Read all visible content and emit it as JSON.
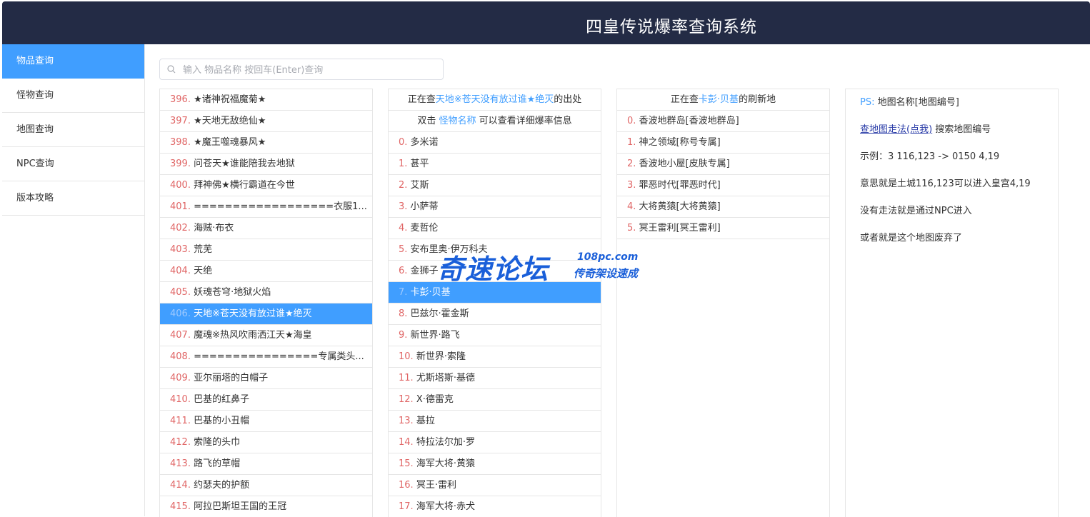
{
  "header": {
    "title": "四皇传说爆率查询系统"
  },
  "sidebar": {
    "items": [
      {
        "label": "物品查询",
        "active": true
      },
      {
        "label": "怪物查询",
        "active": false
      },
      {
        "label": "地图查询",
        "active": false
      },
      {
        "label": "NPC查询",
        "active": false
      },
      {
        "label": "版本攻略",
        "active": false
      }
    ]
  },
  "search": {
    "placeholder": "输入 物品名称 按回车(Enter)查询",
    "value": ""
  },
  "items_list": {
    "selected_index": 10,
    "rows": [
      {
        "num": "396.",
        "name": "★诸神祝福魔菊★"
      },
      {
        "num": "397.",
        "name": "★天地无敌绝仙★"
      },
      {
        "num": "398.",
        "name": "★魔王噬魂暴风★"
      },
      {
        "num": "399.",
        "name": "问苍天★谁能陪我去地狱"
      },
      {
        "num": "400.",
        "name": "拜神佛★横行霸道在今世"
      },
      {
        "num": "401.",
        "name": "==================衣服1..."
      },
      {
        "num": "402.",
        "name": "海贼·布衣"
      },
      {
        "num": "403.",
        "name": "荒芜"
      },
      {
        "num": "404.",
        "name": "天绝"
      },
      {
        "num": "405.",
        "name": "妖魂苍穹·地狱火焰"
      },
      {
        "num": "406.",
        "name": "天地※苍天没有放过谁★绝灭"
      },
      {
        "num": "407.",
        "name": "魔魂※热风吹雨洒江天★海皇"
      },
      {
        "num": "408.",
        "name": "================专属类头..."
      },
      {
        "num": "409.",
        "name": "亚尔丽塔的白帽子"
      },
      {
        "num": "410.",
        "name": "巴基的红鼻子"
      },
      {
        "num": "411.",
        "name": "巴基的小丑帽"
      },
      {
        "num": "412.",
        "name": "索隆的头巾"
      },
      {
        "num": "413.",
        "name": "路飞的草帽"
      },
      {
        "num": "414.",
        "name": "约瑟夫的护额"
      },
      {
        "num": "415.",
        "name": "阿拉巴斯坦王国的王冠"
      }
    ]
  },
  "drop_panel": {
    "header_prefix": "正在查",
    "header_item": "天地※苍天没有放过谁★绝灭",
    "header_suffix": "的出处",
    "hint_prefix": "双击 ",
    "hint_key": "怪物名称",
    "hint_suffix": " 可以查看详细爆率信息",
    "selected_index": 7,
    "rows": [
      {
        "num": "0.",
        "name": "多米诺"
      },
      {
        "num": "1.",
        "name": "甚平"
      },
      {
        "num": "2.",
        "name": "艾斯"
      },
      {
        "num": "3.",
        "name": "小萨蒂"
      },
      {
        "num": "4.",
        "name": "麦哲伦"
      },
      {
        "num": "5.",
        "name": "安布里奥·伊万科夫"
      },
      {
        "num": "6.",
        "name": "金狮子"
      },
      {
        "num": "7.",
        "name": "卡彭·贝基"
      },
      {
        "num": "8.",
        "name": "巴兹尔·霍金斯"
      },
      {
        "num": "9.",
        "name": "新世界·路飞"
      },
      {
        "num": "10.",
        "name": "新世界·索隆"
      },
      {
        "num": "11.",
        "name": "尤斯塔斯·基德"
      },
      {
        "num": "12.",
        "name": "X·德雷克"
      },
      {
        "num": "13.",
        "name": "基拉"
      },
      {
        "num": "14.",
        "name": "特拉法尔加·罗"
      },
      {
        "num": "15.",
        "name": "海军大将·黄猿"
      },
      {
        "num": "16.",
        "name": "冥王·雷利"
      },
      {
        "num": "17.",
        "name": "海军大将·赤犬"
      }
    ]
  },
  "spawn_panel": {
    "header_prefix": "正在查",
    "header_monster": "卡彭·贝基",
    "header_suffix": "的刷新地",
    "rows": [
      {
        "num": "0.",
        "name": "香波地群岛[香波地群岛]"
      },
      {
        "num": "1.",
        "name": "神之领域[称号专属]"
      },
      {
        "num": "2.",
        "name": "香波地小屋[皮肤专属]"
      },
      {
        "num": "3.",
        "name": "罪恶时代[罪恶时代]"
      },
      {
        "num": "4.",
        "name": "大将黄猿[大将黄猿]"
      },
      {
        "num": "5.",
        "name": "冥王雷利[冥王雷利]"
      }
    ]
  },
  "info_panel": {
    "ps_label": "PS:",
    "ps_text": "地图名称[地图编号]",
    "link_text": "查地图走法(点我)",
    "link_suffix": " 搜索地图编号",
    "example": "示例：3 116,123 -> 0150 4,19",
    "meaning": "意思就是土城116,123可以进入皇宫4,19",
    "npc_note": "没有走法就是通过NPC进入",
    "abandoned_note": "或者就是这个地图废弃了"
  },
  "watermark": {
    "main": "奇速论坛",
    "url": "108pc.com",
    "slogan": "传奇架设速成"
  },
  "colors": {
    "header_bg": "#232b45",
    "accent": "#409eff",
    "index_red": "#e06666",
    "border": "#e6e6e6"
  }
}
